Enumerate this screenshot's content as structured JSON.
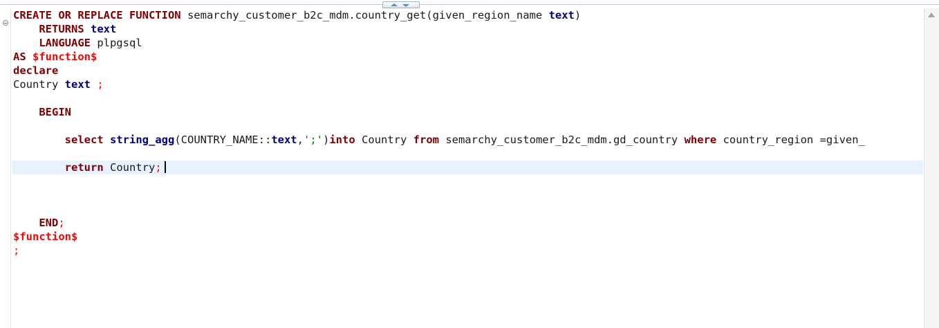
{
  "editor": {
    "lines": [
      [
        {
          "t": "CREATE OR REPLACE FUNCTION",
          "c": "kw"
        },
        {
          "t": " semarchy_customer_b2c_mdm.country_get(given_region_name ",
          "c": ""
        },
        {
          "t": "text",
          "c": "ty"
        },
        {
          "t": ")",
          "c": ""
        }
      ],
      [
        {
          "t": "    ",
          "c": ""
        },
        {
          "t": "RETURNS",
          "c": "kw"
        },
        {
          "t": " ",
          "c": ""
        },
        {
          "t": "text",
          "c": "ty"
        }
      ],
      [
        {
          "t": "    ",
          "c": ""
        },
        {
          "t": "LANGUAGE",
          "c": "kw"
        },
        {
          "t": " plpgsql",
          "c": ""
        }
      ],
      [
        {
          "t": "AS",
          "c": "kw"
        },
        {
          "t": " ",
          "c": ""
        },
        {
          "t": "$function$",
          "c": "red"
        }
      ],
      [
        {
          "t": "declare",
          "c": "kw"
        }
      ],
      [
        {
          "t": "Country ",
          "c": ""
        },
        {
          "t": "text",
          "c": "ty"
        },
        {
          "t": " ;",
          "c": "redn"
        }
      ],
      [],
      [
        {
          "t": "    ",
          "c": ""
        },
        {
          "t": "BEGIN",
          "c": "kw"
        }
      ],
      [],
      [
        {
          "t": "        ",
          "c": ""
        },
        {
          "t": "select",
          "c": "kw"
        },
        {
          "t": " ",
          "c": ""
        },
        {
          "t": "string_agg",
          "c": "ty"
        },
        {
          "t": "(COUNTRY_NAME::",
          "c": ""
        },
        {
          "t": "text",
          "c": "ty"
        },
        {
          "t": ",",
          "c": ""
        },
        {
          "t": "';'",
          "c": "str"
        },
        {
          "t": ")",
          "c": ""
        },
        {
          "t": "into",
          "c": "kw"
        },
        {
          "t": " Country ",
          "c": ""
        },
        {
          "t": "from",
          "c": "kw"
        },
        {
          "t": " semarchy_customer_b2c_mdm.gd_country ",
          "c": ""
        },
        {
          "t": "where",
          "c": "kw"
        },
        {
          "t": " country_region =given_",
          "c": ""
        }
      ],
      [],
      [
        {
          "t": "        ",
          "c": ""
        },
        {
          "t": "return",
          "c": "kw"
        },
        {
          "t": " Country",
          "c": ""
        },
        {
          "t": ";",
          "c": "redn"
        }
      ],
      [],
      [],
      [],
      [
        {
          "t": "    ",
          "c": ""
        },
        {
          "t": "END",
          "c": "kw"
        },
        {
          "t": ";",
          "c": "redn"
        }
      ],
      [
        {
          "t": "$function$",
          "c": "red"
        }
      ],
      [
        {
          "t": ";",
          "c": "redn"
        }
      ]
    ],
    "current_line": 11,
    "colors": {
      "keyword": "#7f0000",
      "type": "#00007f",
      "dollar_quote": "#ff0000",
      "string": "#008000",
      "current_line_bg": "#e8f2fe"
    },
    "icons": {
      "fold": "collapse-fold-icon",
      "scroll_up": "scroll-up-arrow-icon",
      "sash": "sash-toggle-icon"
    }
  }
}
